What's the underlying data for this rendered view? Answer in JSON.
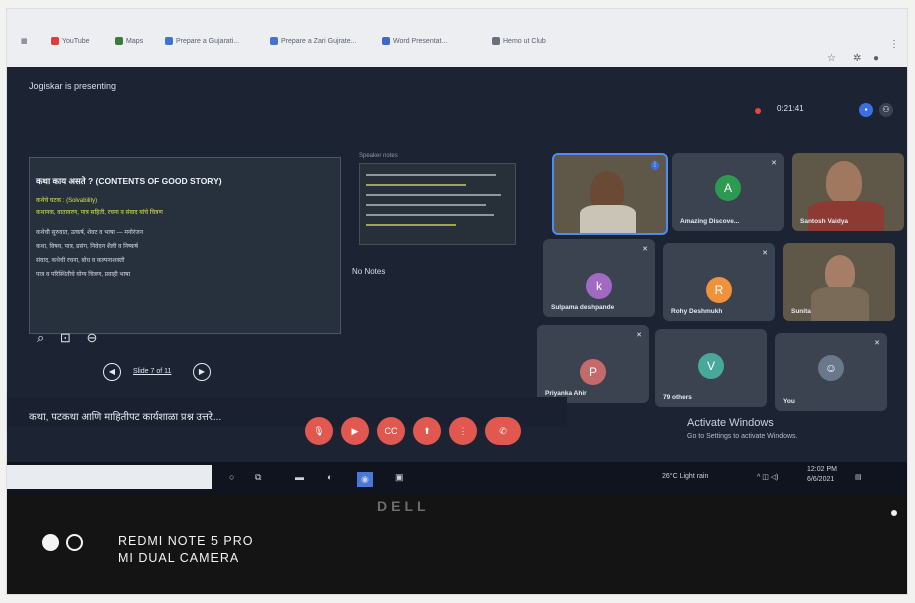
{
  "browser": {
    "bookmarks": [
      "YouTube",
      "Maps",
      "Prepare a Gujarati...",
      "Prepare a Zari Gujrate...",
      "Word Presentat...",
      "Hemo ut Club"
    ],
    "colors": {
      "youtube": "#d8403a",
      "maps": "#3c7b3e",
      "g": "#4173d0",
      "word": "#3f68c9"
    }
  },
  "meeting": {
    "presenting_label": "Jogiskar is presenting",
    "timer": "0:21:41",
    "record_color": "#e8473f"
  },
  "slide": {
    "title": "कथा काय असते ? (CONTENTS OF GOOD STORY)",
    "lines": [
      "कथेचे घटक : (Solvability)",
      "कथानक, वातावरण, पात्र सहिती, रचना व संवाद यांचे चित्रण",
      "कथेची सुरुवात, उत्कर्ष, शेवट व भाषा — मनोरंजन",
      "कथा, विषय, पात्र, प्रसंग, निवेदन शैली व निष्कर्ष",
      "संवाद, कथेची रचना, बोध व कल्पनाशक्ती",
      "पात्र व परिस्थितीचे योग्य चित्रण, प्रवाही भाषा"
    ],
    "counter": "Slide 7 of 11",
    "speaker_notes_label": "Speaker notes",
    "no_notes": "No Notes",
    "subtitle": "कथा, पटकथा आणि माहितीपट कार्यशाळा प्रश्न उत्तरे..."
  },
  "participants": [
    {
      "name": "",
      "type": "video",
      "active": true
    },
    {
      "name": "Amazing Discove...",
      "initial": "A",
      "color": "#2c9a50"
    },
    {
      "name": "Santosh Vaidya",
      "type": "video"
    },
    {
      "name": "Sulpama deshpande",
      "initial": "k",
      "color": "#a06ac2"
    },
    {
      "name": "Rohy Deshmukh",
      "initial": "R",
      "color": "#f0913c"
    },
    {
      "name": "Sunita",
      "type": "video"
    },
    {
      "name": "Priyanka Ahir",
      "initial": "P",
      "color": "#c46a6a"
    },
    {
      "name": "79 others",
      "initial": "V",
      "color": "#4aa89a"
    },
    {
      "name": "You",
      "initial": "",
      "color": "#6b778a"
    }
  ],
  "controls": {
    "colors": [
      "#e0584f",
      "#e0584f",
      "#e0584f",
      "#e0584f",
      "#e0584f",
      "#e0584f"
    ]
  },
  "activation": {
    "title": "Activate Windows",
    "subtitle": "Go to Settings to activate Windows."
  },
  "taskbar": {
    "weather": "26°C Light rain",
    "time": "12:02 PM",
    "date": "6/6/2021"
  },
  "device": {
    "brand": "DELL",
    "watermark_line1": "REDMI NOTE 5 PRO",
    "watermark_line2": "MI DUAL CAMERA"
  }
}
